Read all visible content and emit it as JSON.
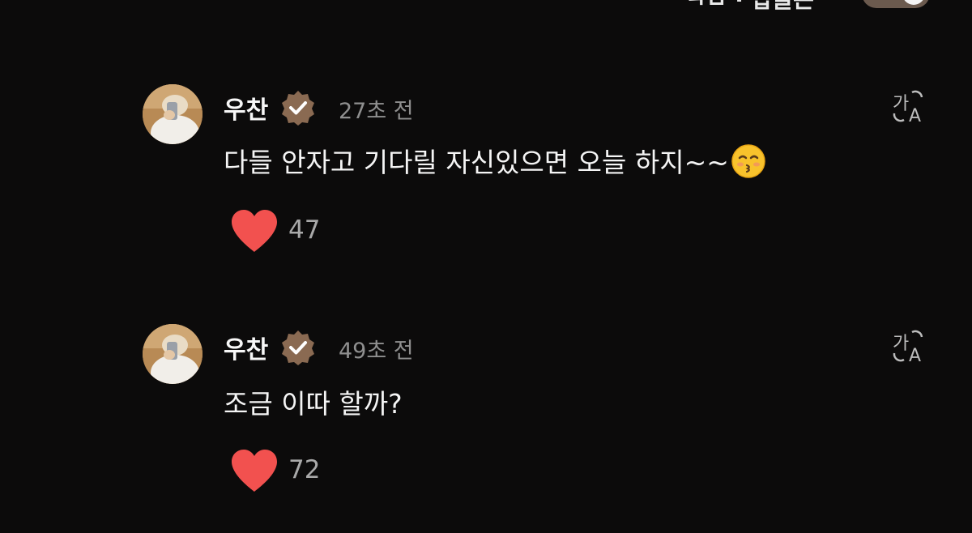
{
  "header": {
    "partial_text": "ㅋㅂ · 답글는",
    "toggle_color": "#6b5a4e"
  },
  "colors": {
    "background": "#0c0b0b",
    "heart": "#f2514f",
    "verified_badge": "#8a6a52",
    "timestamp": "#8f8f8f",
    "like_count": "#a9a9a9"
  },
  "comments": [
    {
      "username": "우찬",
      "verified": true,
      "timestamp": "27초 전",
      "text": "다들 안자고 기다릴 자신있으면 오늘 하지~~",
      "emoji": "kissing-face-smiling-eyes",
      "likes": "47",
      "translate_icon": "translate-icon"
    },
    {
      "username": "우찬",
      "verified": true,
      "timestamp": "49초 전",
      "text": "조금 이따 할까?",
      "emoji": "",
      "likes": "72",
      "translate_icon": "translate-icon"
    }
  ]
}
